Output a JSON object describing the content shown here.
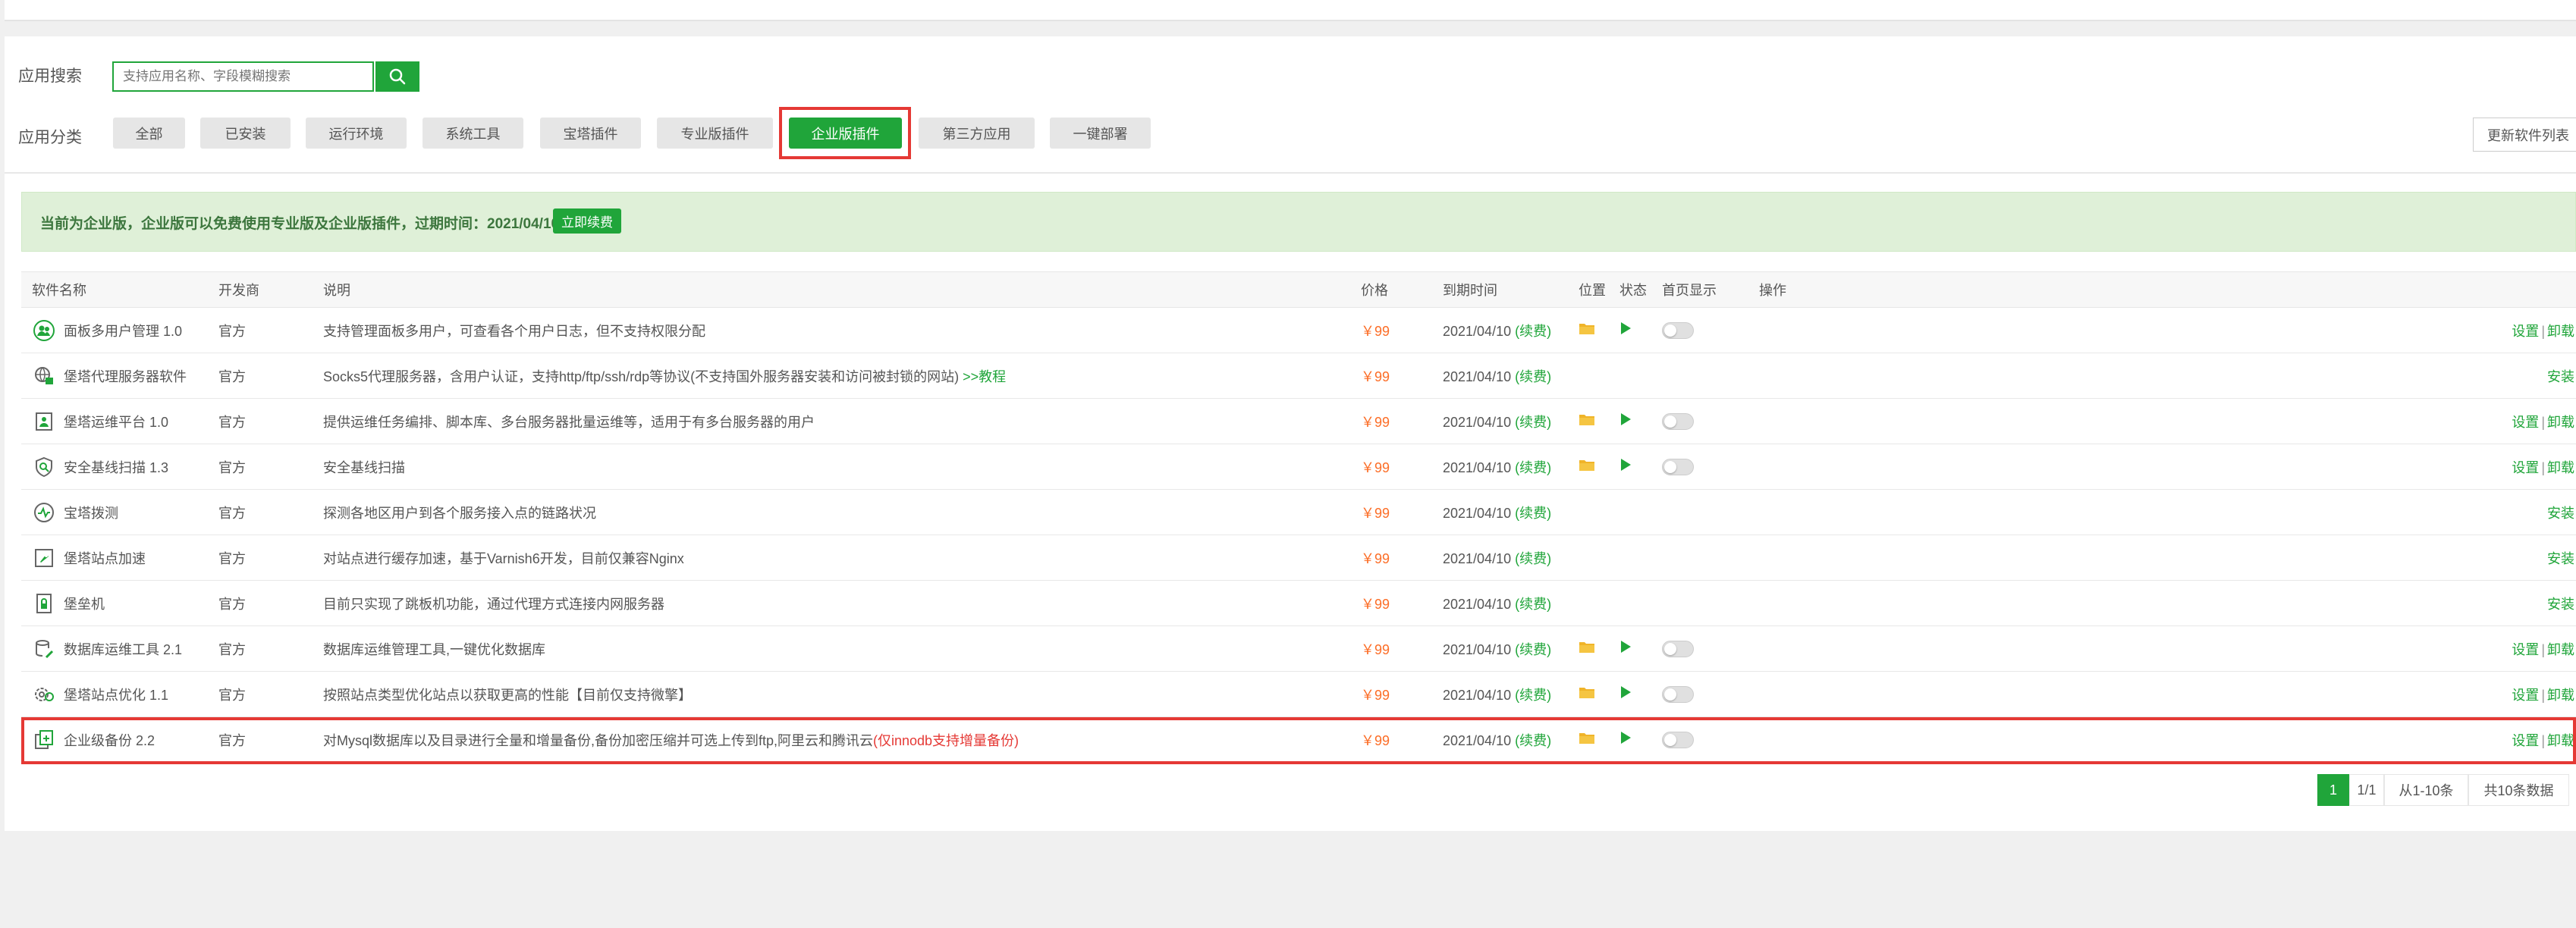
{
  "search": {
    "label": "应用搜索",
    "placeholder": "支持应用名称、字段模糊搜索"
  },
  "categories": {
    "label": "应用分类",
    "items": [
      "全部",
      "已安装",
      "运行环境",
      "系统工具",
      "宝塔插件",
      "专业版插件",
      "企业版插件",
      "第三方应用",
      "一键部署"
    ],
    "active": "企业版插件"
  },
  "update_button": "更新软件列表",
  "notice": {
    "text": "当前为企业版，企业版可以免费使用专业版及企业版插件，过期时间：2021/04/10",
    "renew": "立即续费"
  },
  "table": {
    "headers": {
      "name": "软件名称",
      "vendor": "开发商",
      "desc": "说明",
      "price": "价格",
      "expire": "到期时间",
      "position": "位置",
      "status": "状态",
      "home": "首页显示",
      "ops": "操作"
    },
    "rows": [
      {
        "icon": "users-icon",
        "name": "面板多用户管理 1.0",
        "vendor": "官方",
        "desc": "支持管理面板多用户，可查看各个用户日志，但不支持权限分配",
        "price": "￥99",
        "expire": "2021/04/10",
        "renew": "(续费)",
        "installed": true
      },
      {
        "icon": "proxy-icon",
        "name": "堡塔代理服务器软件",
        "vendor": "官方",
        "desc": "Socks5代理服务器，含用户认证，支持http/ftp/ssh/rdp等协议(不支持国外服务器安装和访问被封锁的网站)",
        "desc_link": ">>教程",
        "price": "￥99",
        "expire": "2021/04/10",
        "renew": "(续费)",
        "installed": false
      },
      {
        "icon": "ops-platform-icon",
        "name": "堡塔运维平台 1.0",
        "vendor": "官方",
        "desc": "提供运维任务编排、脚本库、多台服务器批量运维等，适用于有多台服务器的用户",
        "price": "￥99",
        "expire": "2021/04/10",
        "renew": "(续费)",
        "installed": true
      },
      {
        "icon": "shield-scan-icon",
        "name": "安全基线扫描 1.3",
        "vendor": "官方",
        "desc": "安全基线扫描",
        "price": "￥99",
        "expire": "2021/04/10",
        "renew": "(续费)",
        "installed": true
      },
      {
        "icon": "probe-icon",
        "name": "宝塔拨测",
        "vendor": "官方",
        "desc": "探测各地区用户到各个服务接入点的链路状况",
        "price": "￥99",
        "expire": "2021/04/10",
        "renew": "(续费)",
        "installed": false
      },
      {
        "icon": "rocket-icon",
        "name": "堡塔站点加速",
        "vendor": "官方",
        "desc": "对站点进行缓存加速，基于Varnish6开发，目前仅兼容Nginx",
        "price": "￥99",
        "expire": "2021/04/10",
        "renew": "(续费)",
        "installed": false
      },
      {
        "icon": "bastion-icon",
        "name": "堡垒机",
        "vendor": "官方",
        "desc": "目前只实现了跳板机功能，通过代理方式连接内网服务器",
        "price": "￥99",
        "expire": "2021/04/10",
        "renew": "(续费)",
        "installed": false
      },
      {
        "icon": "database-tool-icon",
        "name": "数据库运维工具 2.1",
        "vendor": "官方",
        "desc": "数据库运维管理工具,一键优化数据库",
        "price": "￥99",
        "expire": "2021/04/10",
        "renew": "(续费)",
        "installed": true
      },
      {
        "icon": "gear-optimize-icon",
        "name": "堡塔站点优化 1.1",
        "vendor": "官方",
        "desc": "按照站点类型优化站点以获取更高的性能【目前仅支持微擎】",
        "price": "￥99",
        "expire": "2021/04/10",
        "renew": "(续费)",
        "installed": true
      },
      {
        "icon": "backup-icon",
        "name": "企业级备份 2.2",
        "vendor": "官方",
        "desc": "对Mysql数据库以及目录进行全量和增量备份,备份加密压缩并可选上传到ftp,阿里云和腾讯云",
        "desc_red": "(仅innodb支持增量备份)",
        "price": "￥99",
        "expire": "2021/04/10",
        "renew": "(续费)",
        "installed": true
      }
    ],
    "action_labels": {
      "settings": "设置",
      "sep": "|",
      "uninstall": "卸载",
      "install": "安装"
    }
  },
  "pagination": {
    "current": "1",
    "pages": "1/1",
    "range": "从1-10条",
    "total": "共10条数据"
  },
  "colors": {
    "primary": "#20a53a",
    "highlight": "#e53935",
    "price": "#fc6d26",
    "notice_bg": "#dff0d8"
  }
}
